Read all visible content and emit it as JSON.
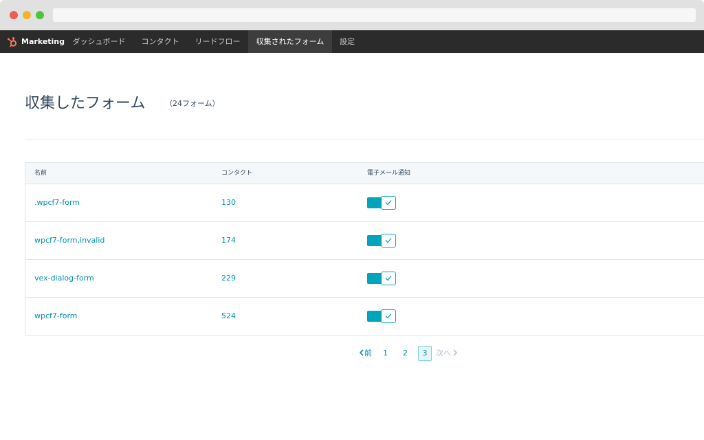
{
  "nav": {
    "brand": "Marketing",
    "items": [
      {
        "label": "ダッシュボード"
      },
      {
        "label": "コンタクト"
      },
      {
        "label": "リードフロー"
      },
      {
        "label": "収集されたフォーム",
        "active": true
      },
      {
        "label": "設定"
      }
    ]
  },
  "page": {
    "title": "収集したフォーム",
    "count": "（24フォーム）"
  },
  "table": {
    "headers": [
      "名前",
      "コンタクト",
      "電子メール通知"
    ],
    "rows": [
      {
        "name": ".wpcf7-form",
        "contacts": "130",
        "notify": true
      },
      {
        "name": "wpcf7-form,invalid",
        "contacts": "174",
        "notify": true
      },
      {
        "name": "vex-dialog-form",
        "contacts": "229",
        "notify": true
      },
      {
        "name": "wpcf7-form",
        "contacts": "524",
        "notify": true
      }
    ]
  },
  "pagination": {
    "prev": "前",
    "pages": [
      "1",
      "2",
      "3"
    ],
    "current": "3",
    "next": "次へ"
  },
  "colors": {
    "nav_bg": "#2b2b2b",
    "accent": "#00a4bd",
    "link": "#0091ae",
    "brand_orange": "#ff7a59"
  }
}
